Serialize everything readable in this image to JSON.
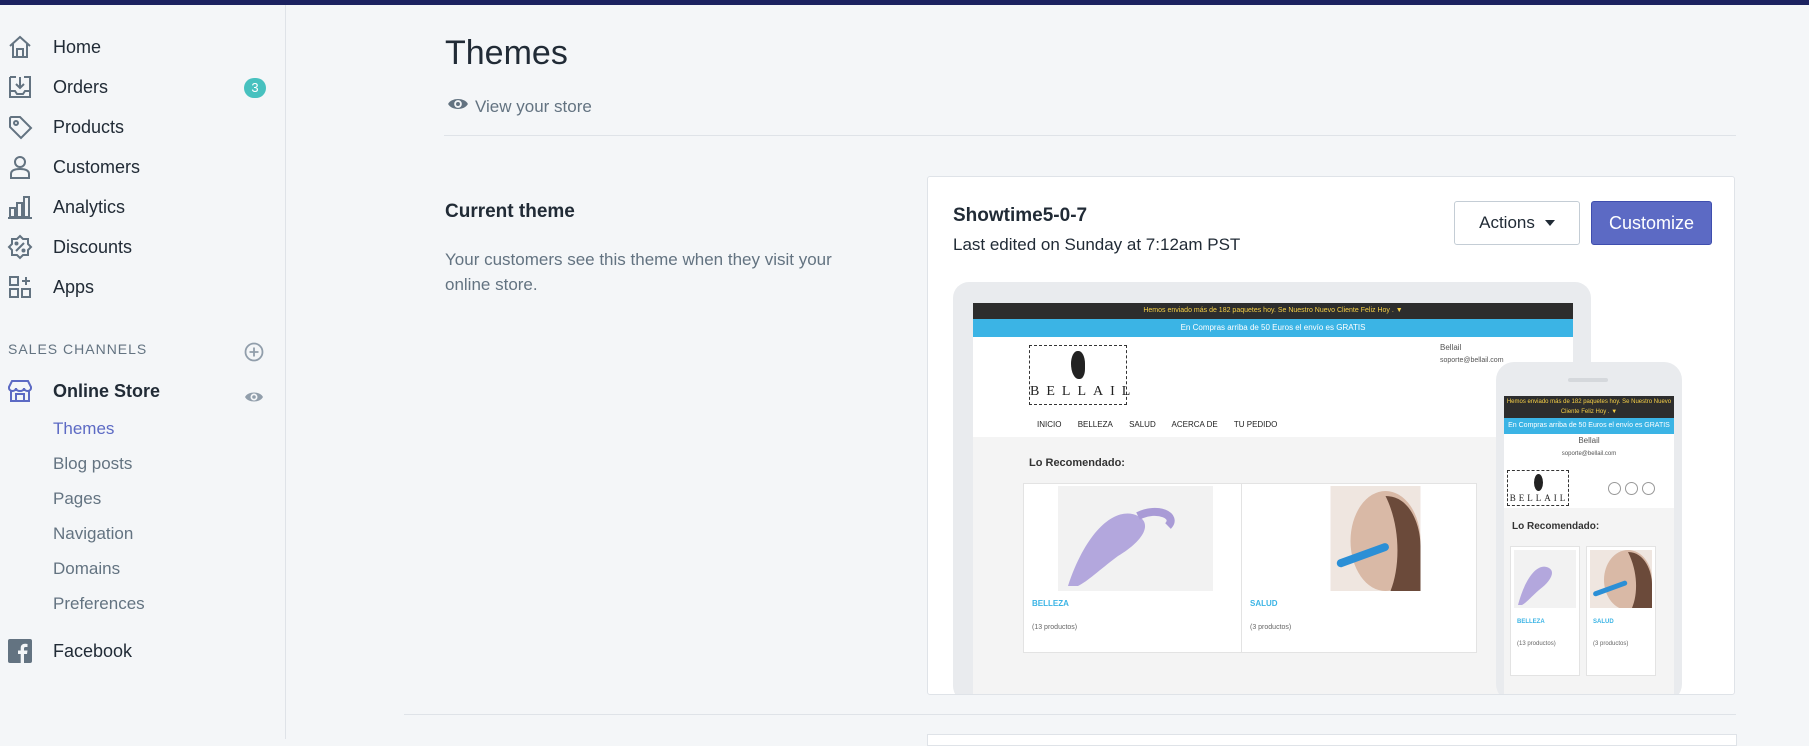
{
  "nav": {
    "home": "Home",
    "orders": "Orders",
    "orders_badge": "3",
    "products": "Products",
    "customers": "Customers",
    "analytics": "Analytics",
    "discounts": "Discounts",
    "apps": "Apps"
  },
  "sales_channels": {
    "title": "SALES CHANNELS",
    "online_store": "Online Store",
    "sub_items": [
      "Themes",
      "Blog posts",
      "Pages",
      "Navigation",
      "Domains",
      "Preferences"
    ],
    "facebook": "Facebook"
  },
  "page": {
    "title": "Themes",
    "view_store": "View your store"
  },
  "current_theme": {
    "heading": "Current theme",
    "description": "Your customers see this theme when they visit your online store."
  },
  "theme_card": {
    "name": "Showtime5-0-7",
    "edited": "Last edited on Sunday at 7:12am PST",
    "actions_label": "Actions",
    "customize_label": "Customize"
  },
  "preview": {
    "top_bar": "Hemos enviado más de 182 paquetes hoy. Se Nuestro Nuevo Cliente Feliz Hoy . ▼",
    "shipping_bar": "En Compras arriba de 50 Euros el envío es GRATIS",
    "brand": "BELLAIL",
    "contact_name": "Bellail",
    "contact_email": "soporte@bellail.com",
    "menu": [
      "INICIO",
      "BELLEZA",
      "SALUD",
      "ACERCA DE",
      "TU PEDIDO"
    ],
    "recommended": "Lo Recomendado:",
    "products": [
      {
        "category": "BELLEZA",
        "count": "(13 productos)"
      },
      {
        "category": "SALUD",
        "count": "(3 productos)"
      }
    ]
  },
  "colors": {
    "accent": "#5c6ac4",
    "badge": "#47c1bf",
    "topbar": "#1c2260"
  }
}
